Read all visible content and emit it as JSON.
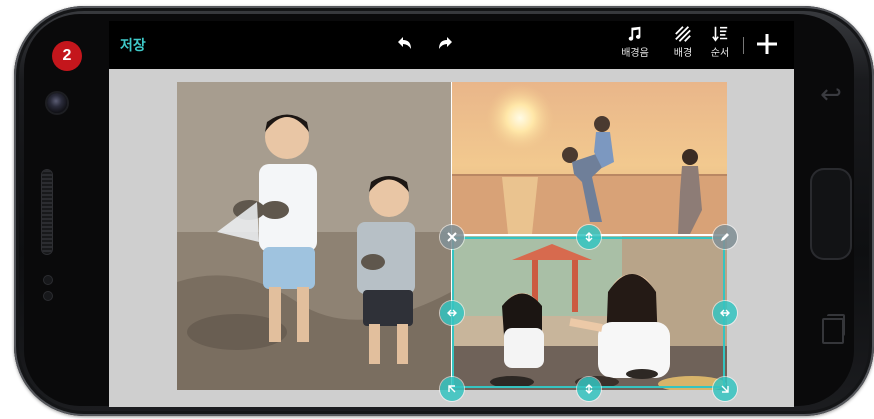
{
  "step_badge": "2",
  "toolbar": {
    "save_label": "저장",
    "music_label": "배경음",
    "background_label": "배경",
    "order_label": "순서"
  },
  "icons": {
    "undo": "undo-icon",
    "redo": "redo-icon",
    "music": "music-note-icon",
    "background": "diagonal-stripes-icon",
    "order": "sort-order-icon",
    "add": "plus-icon",
    "delete": "close-icon",
    "edit": "pencil-icon",
    "move": "arrows-icon"
  },
  "colors": {
    "accent": "#35c4c1",
    "badge": "#c4161c",
    "toolbar_bg": "#000000",
    "screen_bg": "#cfcfcf"
  },
  "photos": [
    {
      "name": "photo-kids-mudflat",
      "description_shown": false
    },
    {
      "name": "photo-family-sunset-beach"
    },
    {
      "name": "photo-mother-daughter-restaurant",
      "selected": true
    }
  ]
}
